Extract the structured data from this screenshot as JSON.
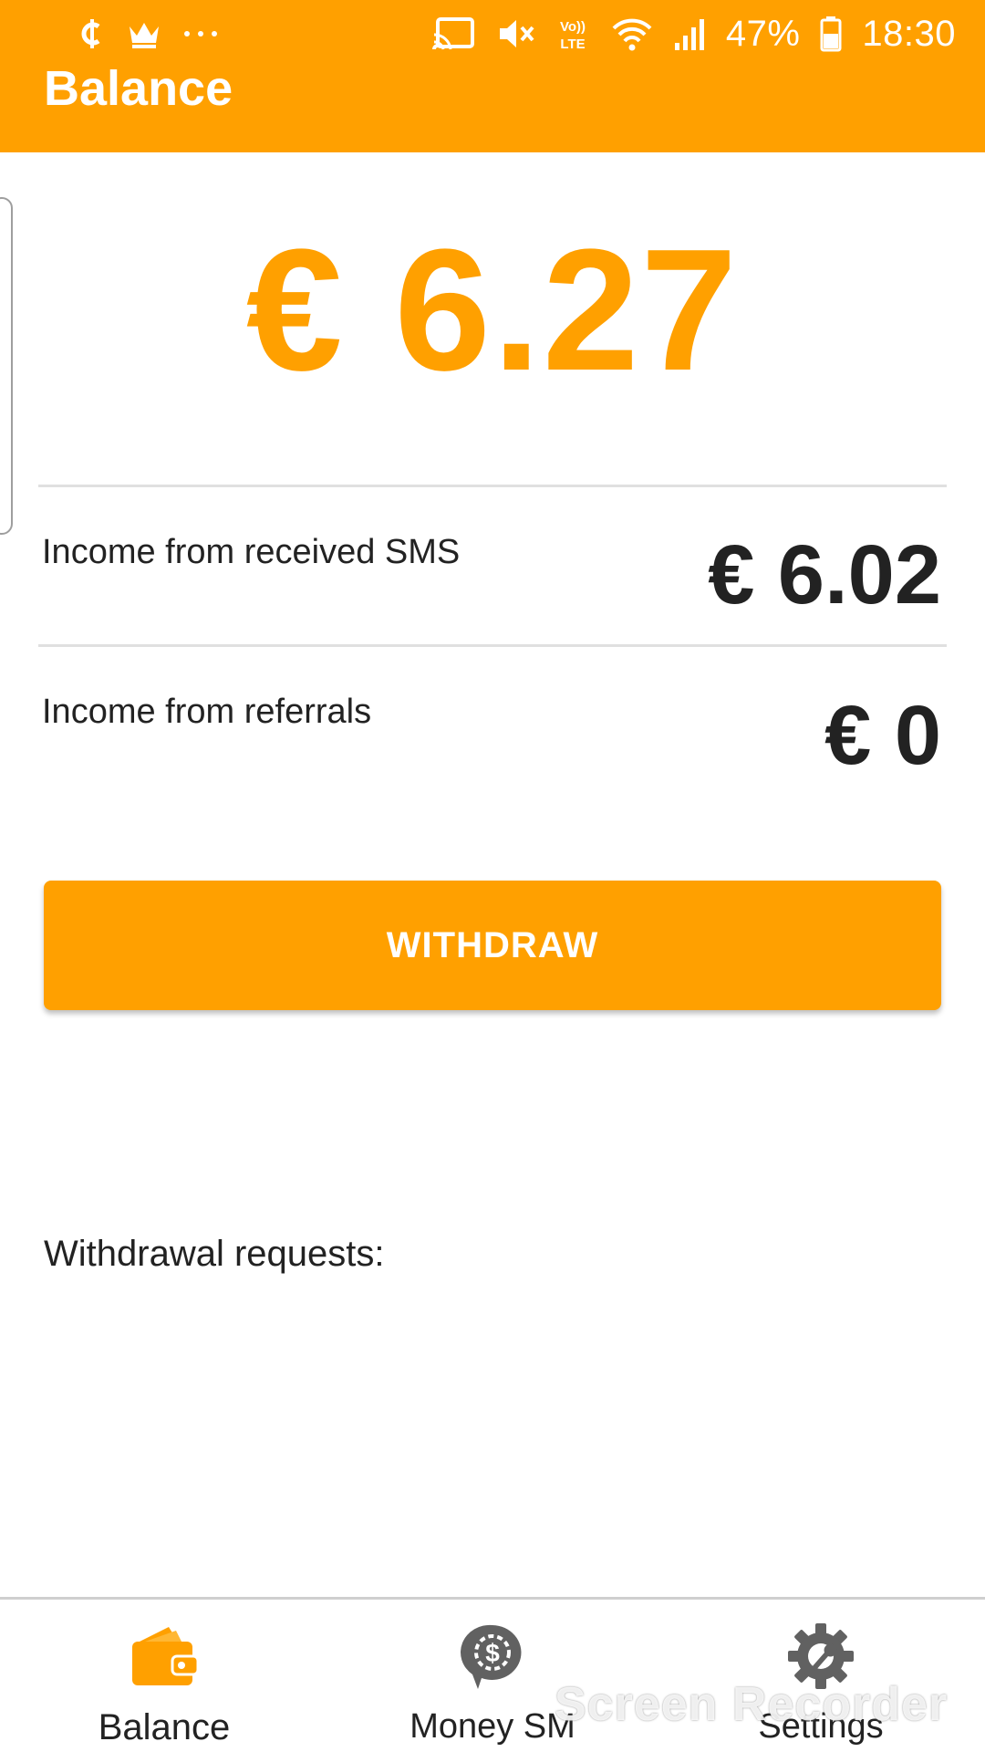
{
  "status_bar": {
    "battery": "47%",
    "time": "18:30",
    "lte_label": "LTE",
    "volte_label": "Vo))",
    "left_icons": [
      "cents-icon",
      "crown-icon",
      "more-dots-icon"
    ],
    "right_icons": [
      "cast-icon",
      "mute-icon",
      "volte-icon",
      "wifi-icon",
      "signal-icon",
      "battery-icon"
    ]
  },
  "appbar": {
    "title": "Balance"
  },
  "balance": {
    "total": "€ 6.27",
    "sms_label": "Income from received SMS",
    "sms_value": "€ 6.02",
    "referrals_label": "Income from referrals",
    "referrals_value": "€ 0"
  },
  "withdraw_button": {
    "label": "WITHDRAW"
  },
  "withdrawal_requests": {
    "label": "Withdrawal requests:"
  },
  "bottom_nav": {
    "items": [
      {
        "label": "Balance",
        "icon": "wallet-icon",
        "active": true
      },
      {
        "label": "Money SM",
        "icon": "money-chat-icon",
        "active": false
      },
      {
        "label": "Settings",
        "icon": "settings-icon",
        "active": false
      }
    ]
  },
  "overlay": {
    "watermark": "Screen Recorder"
  },
  "colors": {
    "accent": "#FFA000",
    "text": "#222222",
    "icon_gray": "#616161"
  }
}
